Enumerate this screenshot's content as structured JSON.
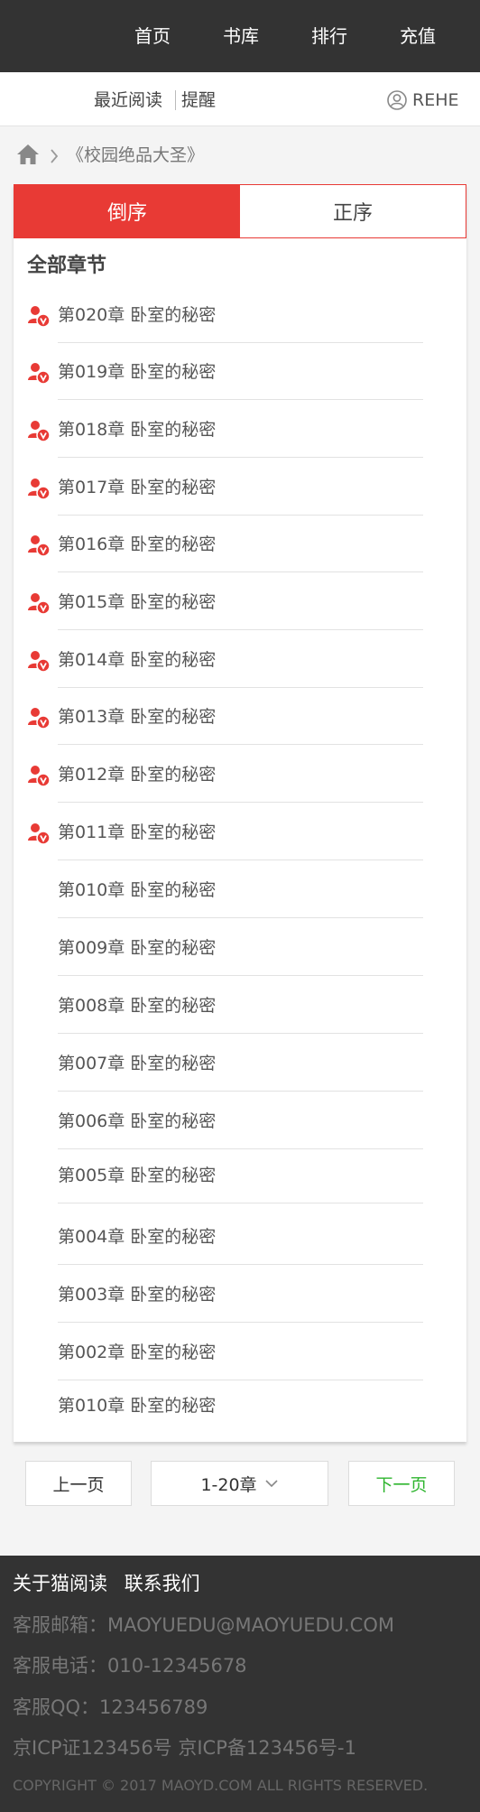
{
  "nav": {
    "items": [
      "首页",
      "书库",
      "排行",
      "充值"
    ]
  },
  "subbar": {
    "recent": "最近阅读",
    "remind": "提醒",
    "user": "REHE"
  },
  "breadcrumb": {
    "book": "《校园绝品大圣》"
  },
  "sort": {
    "desc": "倒序",
    "asc": "正序"
  },
  "chapters_heading": "全部章节",
  "chapters": [
    {
      "title": "第020章 卧室的秘密",
      "vip": true
    },
    {
      "title": "第019章 卧室的秘密",
      "vip": true
    },
    {
      "title": "第018章 卧室的秘密",
      "vip": true
    },
    {
      "title": "第017章 卧室的秘密",
      "vip": true
    },
    {
      "title": "第016章 卧室的秘密",
      "vip": true
    },
    {
      "title": "第015章 卧室的秘密",
      "vip": true
    },
    {
      "title": "第014章 卧室的秘密",
      "vip": true
    },
    {
      "title": "第013章 卧室的秘密",
      "vip": true
    },
    {
      "title": "第012章 卧室的秘密",
      "vip": true
    },
    {
      "title": "第011章 卧室的秘密",
      "vip": true
    },
    {
      "title": "第010章 卧室的秘密",
      "vip": false
    },
    {
      "title": "第009章 卧室的秘密",
      "vip": false
    },
    {
      "title": "第008章 卧室的秘密",
      "vip": false
    },
    {
      "title": "第007章 卧室的秘密",
      "vip": false
    },
    {
      "title": "第006章 卧室的秘密",
      "vip": false
    },
    {
      "title": "第005章 卧室的秘密",
      "vip": false
    },
    {
      "title": "第004章 卧室的秘密",
      "vip": false
    },
    {
      "title": "第003章 卧室的秘密",
      "vip": false
    },
    {
      "title": "第002章 卧室的秘密",
      "vip": false
    },
    {
      "title": "第010章 卧室的秘密",
      "vip": false
    }
  ],
  "pager": {
    "prev": "上一页",
    "range": "1-20章",
    "next": "下一页"
  },
  "footer": {
    "about": "关于猫阅读",
    "contact": "联系我们",
    "email": "客服邮箱：MAOYUEDU@MAOYUEDU.COM",
    "phone": "客服电话：010-12345678",
    "qq": "客服QQ：123456789",
    "icp": "京ICP证123456号 京ICP备123456号-1",
    "copyright": "COPYRIGHT © 2017 MAOYD.COM ALL RIGHTS RESERVED."
  },
  "colors": {
    "accent": "#e83a35",
    "next_green": "#2fb52f",
    "dark_bg": "#333333"
  },
  "icons": [
    "home-icon",
    "user-circle-icon",
    "vip-lock-icon",
    "chevron-down-icon",
    "chevron-right-icon"
  ]
}
